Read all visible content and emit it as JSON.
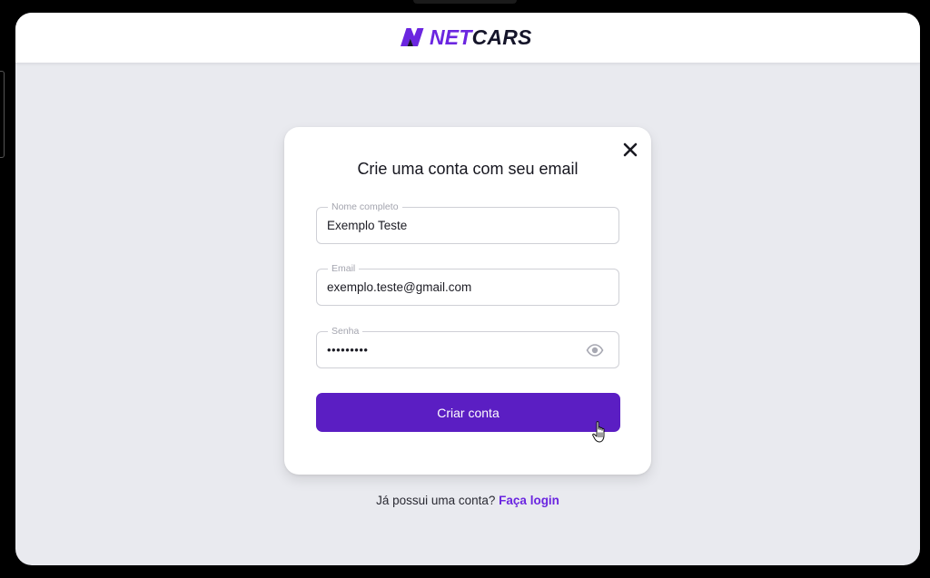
{
  "brand": {
    "name_part1": "NET",
    "name_part2": "CARS",
    "accent_color": "#6b26e0",
    "dark_color": "#15152a"
  },
  "modal": {
    "title": "Crie uma conta com seu email",
    "close_icon": "close-icon",
    "fields": {
      "name": {
        "label": "Nome completo",
        "value": "Exemplo Teste"
      },
      "email": {
        "label": "Email",
        "value": "exemplo.teste@gmail.com"
      },
      "password": {
        "label": "Senha",
        "value": "•••••••••",
        "toggle_icon": "eye-icon"
      }
    },
    "submit_label": "Criar conta",
    "button_color": "#5b1ec3"
  },
  "footer": {
    "prompt": "Já possui uma conta?",
    "link_label": "Faça login"
  }
}
